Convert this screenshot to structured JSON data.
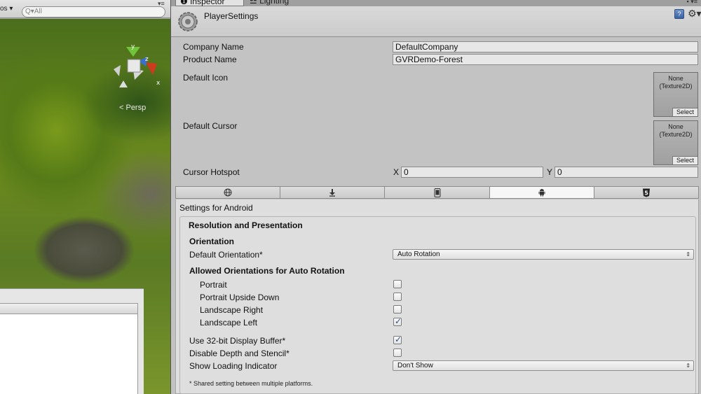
{
  "scene": {
    "toolbar_dropdown": "os ▾",
    "toolbar_menu": "▾≡",
    "search_placeholder": "Q▾All",
    "gizmo": {
      "y": "y",
      "z": "z",
      "x": "x"
    },
    "persp_label": "< Persp"
  },
  "tabs": {
    "inspector": "Inspector",
    "lighting": "Lighting",
    "menu": "▪ ▾≡"
  },
  "header": {
    "title": "PlayerSettings",
    "help": "?",
    "cog": "⚙▾"
  },
  "fields": {
    "company_name_label": "Company Name",
    "company_name_value": "DefaultCompany",
    "product_name_label": "Product Name",
    "product_name_value": "GVRDemo-Forest",
    "default_icon_label": "Default Icon",
    "default_icon_none": "None\n(Texture2D)",
    "default_icon_select": "Select",
    "default_cursor_label": "Default Cursor",
    "default_cursor_none": "None\n(Texture2D)",
    "default_cursor_select": "Select",
    "cursor_hotspot_label": "Cursor Hotspot",
    "hotspot_x_label": "X",
    "hotspot_x_value": "0",
    "hotspot_y_label": "Y",
    "hotspot_y_value": "0"
  },
  "platform_tabs": [
    {
      "icon": "globe-icon",
      "active": false
    },
    {
      "icon": "download-icon",
      "active": false
    },
    {
      "icon": "phone-icon",
      "active": false
    },
    {
      "icon": "android-icon",
      "active": true
    },
    {
      "icon": "html5-icon",
      "active": false
    }
  ],
  "android": {
    "settings_for": "Settings for Android",
    "section_title": "Resolution and Presentation",
    "orientation_heading": "Orientation",
    "default_orientation_label": "Default Orientation*",
    "default_orientation_value": "Auto Rotation",
    "allowed_heading": "Allowed Orientations for Auto Rotation",
    "portrait": {
      "label": "Portrait",
      "checked": false
    },
    "portrait_upside_down": {
      "label": "Portrait Upside Down",
      "checked": false
    },
    "landscape_right": {
      "label": "Landscape Right",
      "checked": false
    },
    "landscape_left": {
      "label": "Landscape Left",
      "checked": true
    },
    "use_32bit": {
      "label": "Use 32-bit Display Buffer*",
      "checked": true
    },
    "disable_depth": {
      "label": "Disable Depth and Stencil*",
      "checked": false
    },
    "loading_indicator_label": "Show Loading Indicator",
    "loading_indicator_value": "Don't Show",
    "dropdown_arrow": "⇕",
    "footnote": "* Shared setting between multiple platforms."
  },
  "colors": {
    "checkbox_tick": "#2f4f86",
    "active_tab": "#f7f7f7"
  }
}
